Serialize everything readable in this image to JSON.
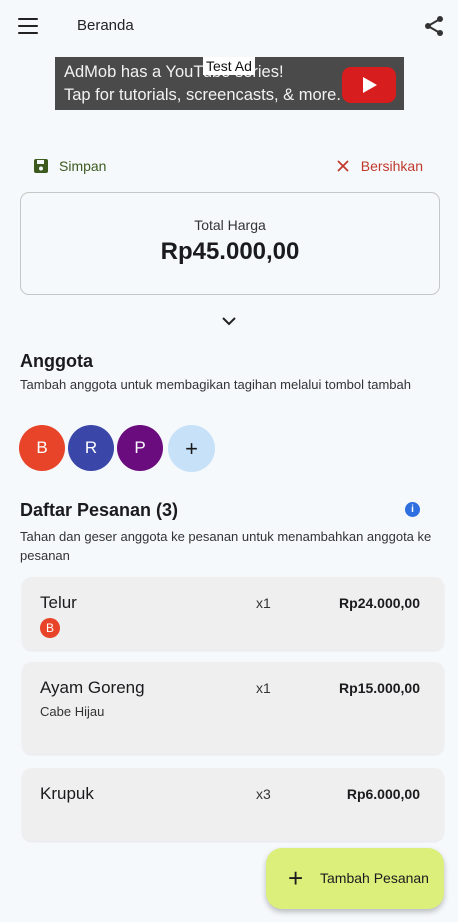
{
  "appbar": {
    "title": "Beranda",
    "menu_icon": "menu-icon",
    "share_icon": "share-icon"
  },
  "ad": {
    "line1": "AdMob has a YouTube series!",
    "line2": "Tap for tutorials, screencasts, & more.",
    "badge": "Test Ad"
  },
  "actions": {
    "save_label": "Simpan",
    "clear_label": "Bersihkan"
  },
  "total": {
    "label": "Total Harga",
    "value": "Rp45.000,00"
  },
  "members": {
    "title": "Anggota",
    "description": "Tambah anggota untuk membagikan tagihan melalui tombol tambah",
    "avatars": [
      {
        "initial": "B",
        "color": "#e8442a"
      },
      {
        "initial": "R",
        "color": "#3a46a8"
      },
      {
        "initial": "P",
        "color": "#6a0c7e"
      }
    ],
    "add_label": "+"
  },
  "orders": {
    "title": "Daftar Pesanan (3)",
    "description": "Tahan dan geser anggota ke pesanan untuk menambahkan anggota ke pesanan",
    "items": [
      {
        "name": "Telur",
        "qty": "x1",
        "price": "Rp24.000,00",
        "assignee": "B"
      },
      {
        "name": "Ayam Goreng",
        "qty": "x1",
        "price": "Rp15.000,00",
        "note": "Cabe Hijau"
      },
      {
        "name": "Krupuk",
        "qty": "x3",
        "price": "Rp6.000,00"
      }
    ]
  },
  "fab": {
    "label": "Tambah Pesanan",
    "plus": "+"
  },
  "colors": {
    "accent_green": "#3d5a1e",
    "danger": "#c0392b",
    "fab_bg": "#dcef7a"
  }
}
